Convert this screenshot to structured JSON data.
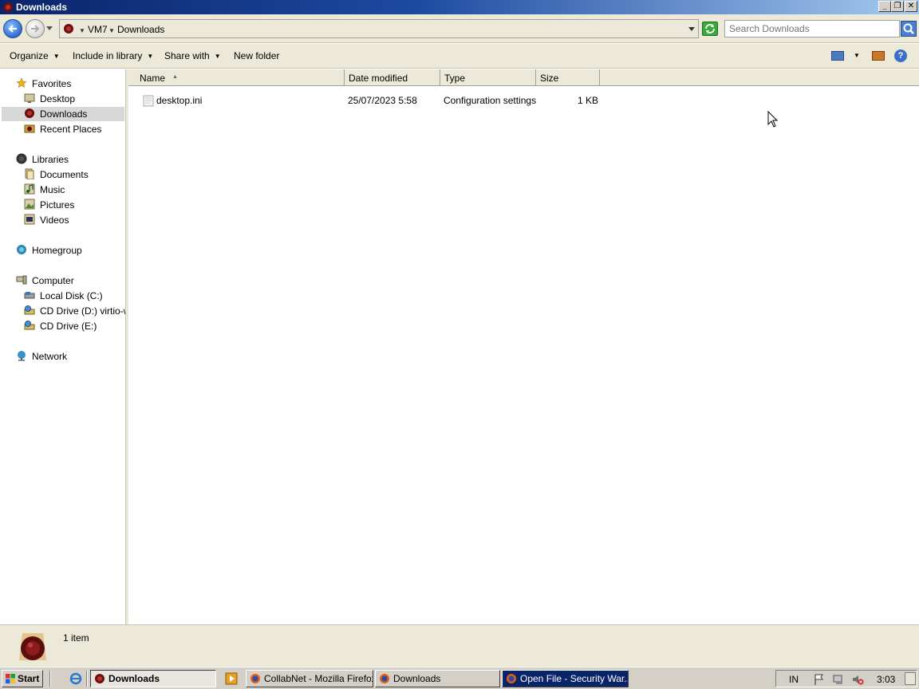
{
  "window": {
    "title": "Downloads"
  },
  "address": {
    "breadcrumbs": [
      "VM7",
      "Downloads"
    ],
    "search_placeholder": "Search Downloads"
  },
  "toolbar": {
    "organize": "Organize",
    "include_in_library": "Include in library",
    "share_with": "Share with",
    "new_folder": "New folder"
  },
  "nav": {
    "favorites": "Favorites",
    "desktop": "Desktop",
    "downloads": "Downloads",
    "recent_places": "Recent Places",
    "libraries": "Libraries",
    "documents": "Documents",
    "music": "Music",
    "pictures": "Pictures",
    "videos": "Videos",
    "homegroup": "Homegroup",
    "computer": "Computer",
    "local_disk": "Local Disk (C:)",
    "cd_drive_d": "CD Drive (D:) virtio-win",
    "cd_drive_e": "CD Drive (E:)",
    "network": "Network"
  },
  "columns": {
    "name": "Name",
    "date_modified": "Date modified",
    "type": "Type",
    "size": "Size"
  },
  "files": [
    {
      "name": "desktop.ini",
      "date_modified": "25/07/2023 5:58",
      "type": "Configuration settings",
      "size": "1 KB"
    }
  ],
  "details": {
    "item_count": "1 item"
  },
  "taskbar": {
    "start": "Start",
    "tasks": [
      {
        "label": "Downloads",
        "state": "active"
      },
      {
        "label": "CollabNet - Mozilla Firefox",
        "state": "normal"
      },
      {
        "label": "Downloads",
        "state": "normal"
      },
      {
        "label": "Open File - Security War...",
        "state": "flash"
      }
    ],
    "language": "IN",
    "clock": "3:03"
  },
  "colors": {
    "selection": "#d8d8d8",
    "chrome": "#ece9d8",
    "taskbar": "#d4d0c8",
    "titlebar": "#0a246a"
  }
}
